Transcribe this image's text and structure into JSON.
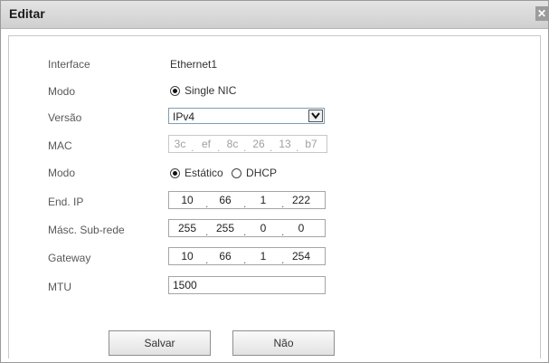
{
  "dialog": {
    "title": "Editar",
    "close_glyph": "✕"
  },
  "fields": {
    "interface": {
      "label": "Interface",
      "value": "Ethernet1"
    },
    "nic_mode": {
      "label": "Modo",
      "option": "Single NIC"
    },
    "version": {
      "label": "Versão",
      "selected": "IPv4"
    },
    "mac": {
      "label": "MAC",
      "octets": [
        "3c",
        "ef",
        "8c",
        "26",
        "13",
        "b7"
      ]
    },
    "ip_mode": {
      "label": "Modo",
      "options": [
        "Estático",
        "DHCP"
      ],
      "selected": "Estático"
    },
    "ip_address": {
      "label": "End. IP",
      "octets": [
        "10",
        "66",
        "1",
        "222"
      ]
    },
    "subnet": {
      "label": "Másc. Sub-rede",
      "octets": [
        "255",
        "255",
        "0",
        "0"
      ]
    },
    "gateway": {
      "label": "Gateway",
      "octets": [
        "10",
        "66",
        "1",
        "254"
      ]
    },
    "mtu": {
      "label": "MTU",
      "value": "1500"
    }
  },
  "buttons": {
    "save": "Salvar",
    "cancel": "Não"
  },
  "icons": {
    "close": "close-icon",
    "dropdown": "chevron-down-icon"
  }
}
